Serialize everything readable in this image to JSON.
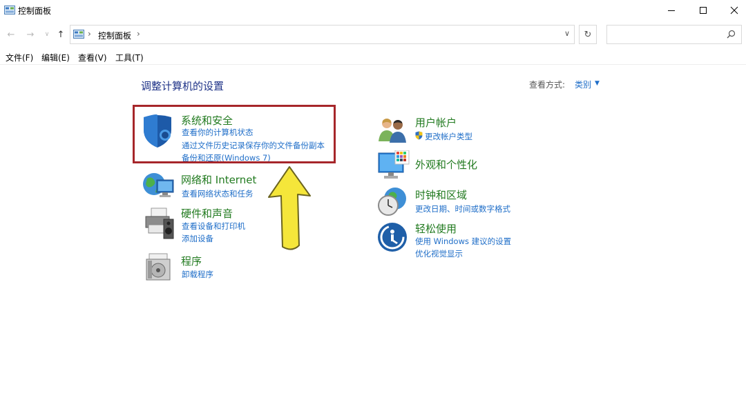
{
  "window": {
    "title": "控制面板",
    "minimize": "—",
    "maximize": "□",
    "close": "✕"
  },
  "nav": {
    "back": "←",
    "forward": "→",
    "recent": "∨",
    "up": "↑",
    "breadcrumb_sep1": "›",
    "breadcrumb_sep2": "›",
    "breadcrumb": "控制面板",
    "address_dropdown": "∨",
    "refresh": "↻",
    "search_placeholder": ""
  },
  "menu": {
    "file": "文件(F)",
    "edit": "编辑(E)",
    "view": "查看(V)",
    "tools": "工具(T)"
  },
  "main": {
    "heading": "调整计算机的设置",
    "view_by_label": "查看方式:",
    "view_by_value": "类别",
    "view_by_arrow": "▼"
  },
  "categories_left": [
    {
      "title": "系统和安全",
      "links": [
        "查看你的计算机状态",
        "通过文件历史记录保存你的文件备份副本",
        "备份和还原(Windows 7)"
      ]
    },
    {
      "title": "网络和 Internet",
      "links": [
        "查看网络状态和任务"
      ]
    },
    {
      "title": "硬件和声音",
      "links": [
        "查看设备和打印机",
        "添加设备"
      ]
    },
    {
      "title": "程序",
      "links": [
        "卸载程序"
      ]
    }
  ],
  "categories_right": [
    {
      "title": "用户帐户",
      "links": [
        "更改帐户类型"
      ]
    },
    {
      "title": "外观和个性化",
      "links": []
    },
    {
      "title": "时钟和区域",
      "links": [
        "更改日期、时间或数字格式"
      ]
    },
    {
      "title": "轻松使用",
      "links": [
        "使用 Windows 建议的设置",
        "优化视觉显示"
      ]
    }
  ],
  "colors": {
    "heading": "#1e3287",
    "category_title": "#217a1f",
    "link": "#1f6ec8",
    "highlight_box": "#a6262a",
    "arrow": "#f5e63a"
  }
}
